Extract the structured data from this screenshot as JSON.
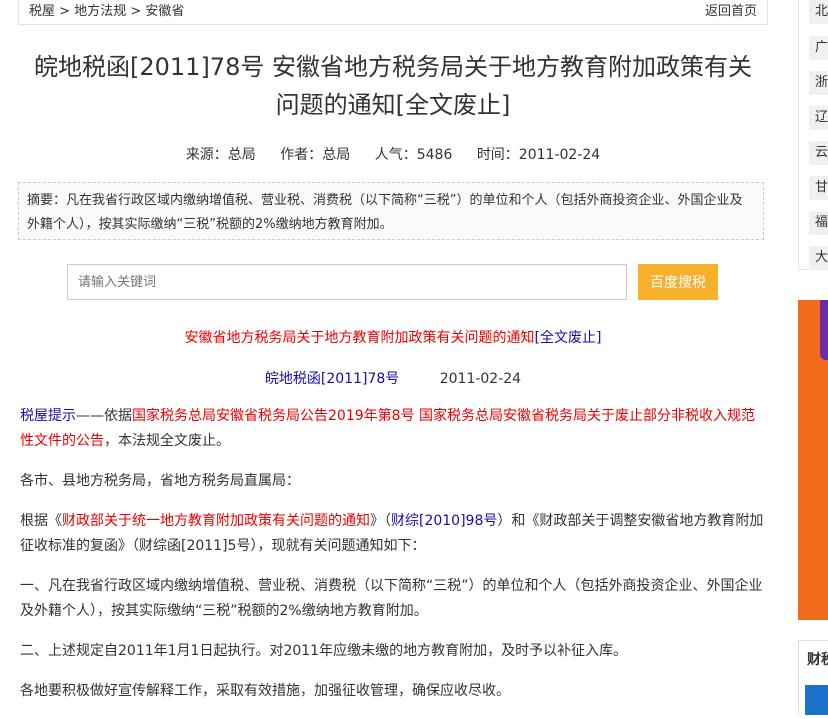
{
  "breadcrumb": {
    "items": [
      "税屋",
      ">",
      "地方法规",
      ">",
      "安徽省"
    ],
    "home": "返回首页"
  },
  "title_line1": "皖地税函[2011]78号 安徽省地方税务局关于地方教育附加政策有关",
  "title_line2": "问题的通知[全文废止]",
  "meta": {
    "source": "来源：总局",
    "author": "作者：总局",
    "views": "人气：5486",
    "time": "时间：2011-02-24"
  },
  "abstract": "摘要：凡在我省行政区域内缴纳增值税、营业税、消费税（以下简称“三税”）的单位和个人（包括外商投资企业、外国企业及外籍个人），按其实际缴纳“三税”税额的2%缴纳地方教育附加。",
  "search": {
    "placeholder": "请输入关键词",
    "button": "百度搜税"
  },
  "subtitle": {
    "text": "安徽省地方税务局关于地方教育附加政策有关问题的通知",
    "link": "[全文废止]"
  },
  "docno": {
    "number": "皖地税函[2011]78号",
    "date": "2011-02-24"
  },
  "notice": {
    "label": "税屋提示",
    "dash": "——依据",
    "basis": "国家税务总局安徽省税务局公告2019年第8号 国家税务总局安徽省税务局关于废止部分非税收入规范性文件的公告",
    "tail": "，本法规全文废止。"
  },
  "para_addressee": "各市、县地方税务局，省地方税务局直属局：",
  "para_basis": {
    "pre": "根据《",
    "doc1": "财政部关于统一地方教育附加政策有关问题的通知",
    "mid1": "》（",
    "doc1no": "财综[2010]98号",
    "mid2": "）和《财政部关于调整安徽省地方教育附加征收标准的复函》（财综函[2011]5号），现就有关问题通知如下："
  },
  "para1": "一、凡在我省行政区域内缴纳增值税、营业税、消费税（以下简称“三税”）的单位和个人（包括外商投资企业、外国企业及外籍个人），按其实际缴纳“三税”税额的2%缴纳地方教育附加。",
  "para2": "二、上述规定自2011年1月1日起执行。对2011年应缴未缴的地方教育附加，及时予以补征入库。",
  "para3": "各地要积极做好宣传解释工作，采取有效措施，加强征收管理，确保应收尽收。",
  "sidebar": {
    "items": [
      "北",
      "广",
      "浙",
      "辽",
      "云",
      "甘",
      "福",
      "大"
    ],
    "finance_label": "财税"
  },
  "colors": {
    "accent": "#f8b02c",
    "link": "#1a0dab",
    "red": "#e00000",
    "banner": "#f36b1c"
  }
}
